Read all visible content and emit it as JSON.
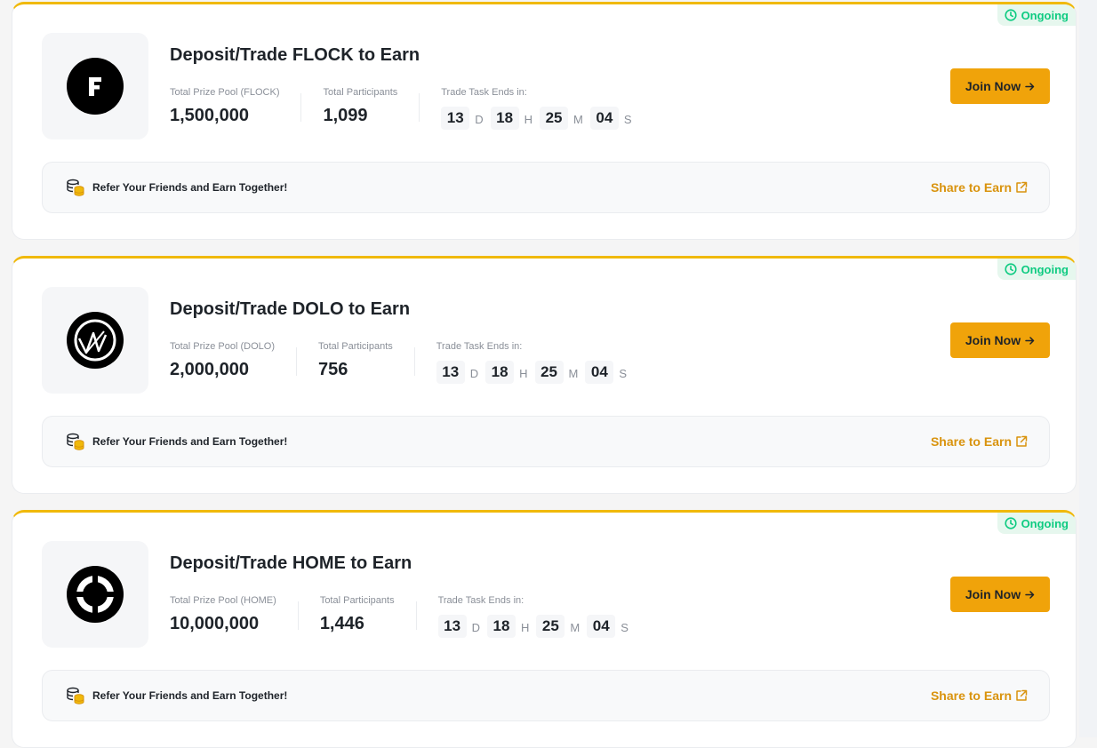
{
  "status_label": "Ongoing",
  "colors": {
    "accent": "#f0a30a",
    "status": "#0ecb81",
    "link": "#d9930d"
  },
  "countdown_units": {
    "d": "D",
    "h": "H",
    "m": "M",
    "s": "S"
  },
  "cards": [
    {
      "token": "FLOCK",
      "logo_icon": "flock-logo-icon",
      "title": "Deposit/Trade FLOCK to Earn",
      "prize_label": "Total Prize Pool (FLOCK)",
      "prize_value": "1,500,000",
      "participants_label": "Total Participants",
      "participants_value": "1,099",
      "ends_label": "Trade Task Ends in:",
      "countdown": {
        "d": "13",
        "h": "18",
        "m": "25",
        "s": "04"
      },
      "join_label": "Join Now",
      "refer_text": "Refer Your Friends and Earn Together!",
      "share_label": "Share to Earn"
    },
    {
      "token": "DOLO",
      "logo_icon": "dolo-logo-icon",
      "title": "Deposit/Trade DOLO to Earn",
      "prize_label": "Total Prize Pool (DOLO)",
      "prize_value": "2,000,000",
      "participants_label": "Total Participants",
      "participants_value": "756",
      "ends_label": "Trade Task Ends in:",
      "countdown": {
        "d": "13",
        "h": "18",
        "m": "25",
        "s": "04"
      },
      "join_label": "Join Now",
      "refer_text": "Refer Your Friends and Earn Together!",
      "share_label": "Share to Earn"
    },
    {
      "token": "HOME",
      "logo_icon": "home-logo-icon",
      "title": "Deposit/Trade HOME to Earn",
      "prize_label": "Total Prize Pool (HOME)",
      "prize_value": "10,000,000",
      "participants_label": "Total Participants",
      "participants_value": "1,446",
      "ends_label": "Trade Task Ends in:",
      "countdown": {
        "d": "13",
        "h": "18",
        "m": "25",
        "s": "04"
      },
      "join_label": "Join Now",
      "refer_text": "Refer Your Friends and Earn Together!",
      "share_label": "Share to Earn"
    }
  ]
}
